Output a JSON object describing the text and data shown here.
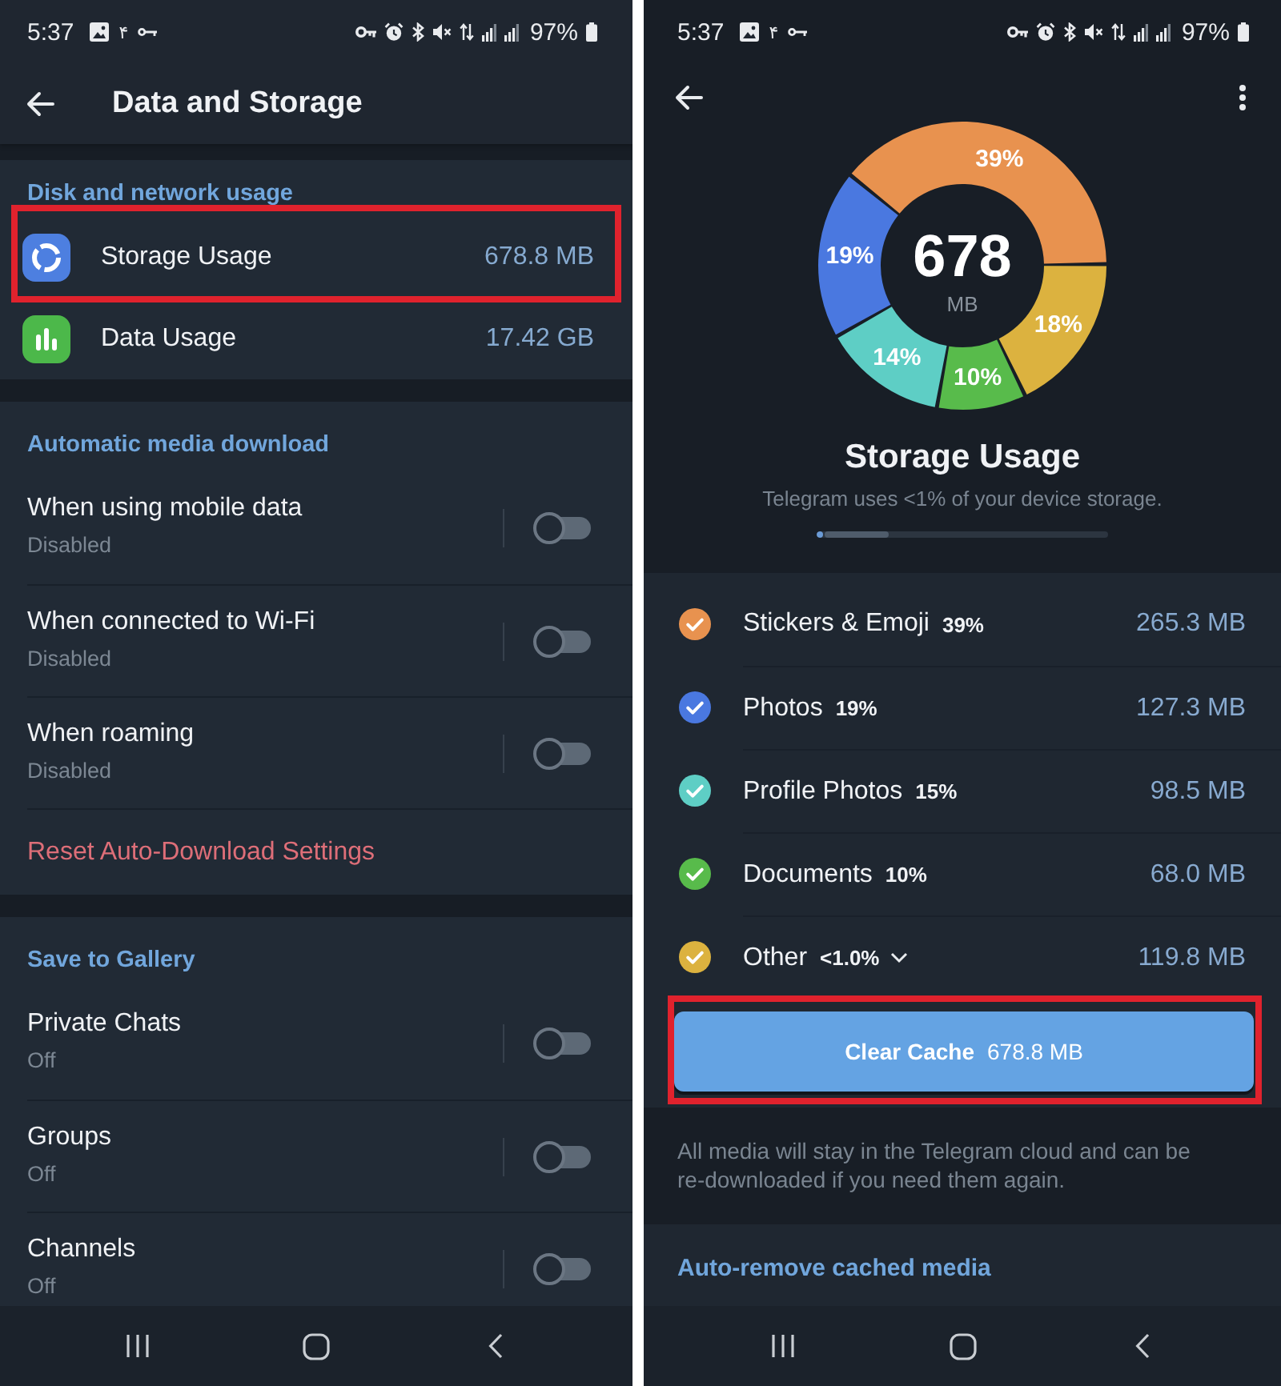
{
  "left_screen": {
    "status_bar": {
      "time": "5:37",
      "notification_glyph": "۴",
      "battery": "97%"
    },
    "app_bar": {
      "title": "Data and Storage"
    },
    "sections": [
      {
        "header": "Disk and network usage",
        "rows": [
          {
            "kind": "link",
            "label": "Storage Usage",
            "value": "678.8 MB",
            "color": "#4d7fe0",
            "highlighted": true
          },
          {
            "kind": "link",
            "label": "Data Usage",
            "value": "17.42 GB",
            "color": "#4cb84a",
            "highlighted": false
          }
        ]
      },
      {
        "header": "Automatic media download",
        "rows": [
          {
            "kind": "toggle",
            "label": "When using mobile data",
            "subtitle": "Disabled",
            "on": false
          },
          {
            "kind": "toggle",
            "label": "When connected to Wi-Fi",
            "subtitle": "Disabled",
            "on": false
          },
          {
            "kind": "toggle",
            "label": "When roaming",
            "subtitle": "Disabled",
            "on": false
          },
          {
            "kind": "action",
            "label": "Reset Auto-Download Settings"
          }
        ]
      },
      {
        "header": "Save to Gallery",
        "rows": [
          {
            "kind": "toggle",
            "label": "Private Chats",
            "subtitle": "Off",
            "on": false
          },
          {
            "kind": "toggle",
            "label": "Groups",
            "subtitle": "Off",
            "on": false
          },
          {
            "kind": "toggle",
            "label": "Channels",
            "subtitle": "Off",
            "on": false
          }
        ]
      }
    ]
  },
  "right_screen": {
    "status_bar": {
      "time": "5:37",
      "notification_glyph": "۴",
      "battery": "97%"
    },
    "donut": {
      "center_value": "678",
      "center_unit": "MB",
      "slices": [
        {
          "color": "#e8924f"
        },
        {
          "color": "#dcb23f"
        },
        {
          "color": "#58bb4b"
        },
        {
          "color": "#5ecec5"
        },
        {
          "color": "#4a78e0"
        }
      ],
      "chart_data": {
        "type": "donut",
        "values": [
          39,
          18,
          10,
          14,
          19
        ],
        "value_labels": [
          "39%",
          "18%",
          "10%",
          "14%",
          "19%"
        ]
      }
    },
    "title": "Storage Usage",
    "subtitle": "Telegram uses <1% of your device storage.",
    "storage_bar": {
      "telegram": {
        "level": 0.02
      },
      "other_apps": {
        "level": 0.22
      }
    },
    "categories": [
      {
        "kind": "single",
        "name": "Stickers & Emoji",
        "percent": "39%",
        "size": "265.3 MB",
        "color": "#e8924f",
        "checked": true
      },
      {
        "kind": "single",
        "name": "Photos",
        "percent": "19%",
        "size": "127.3 MB",
        "color": "#4a78e0",
        "checked": true
      },
      {
        "kind": "single",
        "name": "Profile Photos",
        "percent": "15%",
        "size": "98.5 MB",
        "color": "#5ecec5",
        "checked": true
      },
      {
        "kind": "single",
        "name": "Documents",
        "percent": "10%",
        "size": "68.0 MB",
        "color": "#58bb4b",
        "checked": true
      },
      {
        "kind": "group",
        "name": "Other",
        "percent": "<1.0%",
        "size": "119.8 MB",
        "color": "#dcb23f",
        "checked": true,
        "expanded": false
      }
    ],
    "clear_button": {
      "label": "Clear Cache",
      "size": "678.8 MB",
      "highlighted": true
    },
    "note": "All media will stay in the Telegram cloud and can be re-downloaded if you need them again.",
    "auto_remove_header": "Auto-remove cached media"
  }
}
